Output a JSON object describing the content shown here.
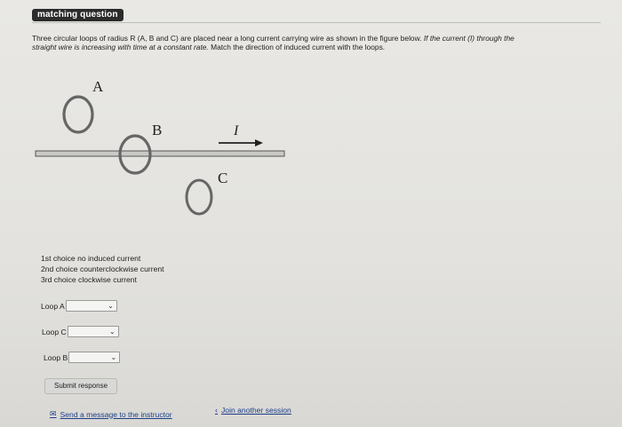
{
  "header": {
    "tag": "matching question"
  },
  "question": {
    "text_plain": "Three circular loops of radius R (A, B and C) are placed near a long current carrying wire as shown in the figure below. ",
    "text_italic_1": "If the current (I) through the",
    "text_italic_2": "straight wire is increasing with time at a constant rate.",
    "text_plain_2": " Match the direction of induced current with the loops."
  },
  "figure": {
    "label_a": "A",
    "label_b": "B",
    "label_c": "C",
    "label_current": "I"
  },
  "choices": [
    "1st choice  no induced current",
    "2nd choice counterclockwise current",
    "3rd choice  clockwise current"
  ],
  "loops": [
    {
      "label": "Loop A",
      "value": ""
    },
    {
      "label": "Loop C",
      "value": ""
    },
    {
      "label": "Loop B",
      "value": ""
    }
  ],
  "buttons": {
    "submit": "Submit response"
  },
  "footer": {
    "message_link": "Send a message to the instructor",
    "join_link": "Join another session"
  }
}
